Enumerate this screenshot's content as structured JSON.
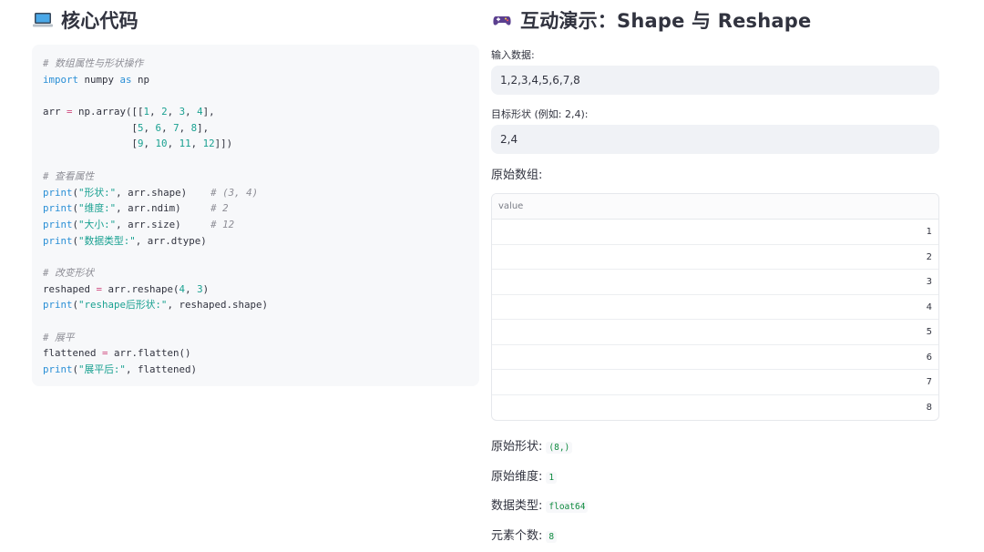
{
  "left": {
    "title_icon": "laptop-icon",
    "title": "核心代码",
    "code_lines": [
      "# 数组属性与形状操作",
      "import numpy as np",
      "",
      "arr = np.array([[1, 2, 3, 4],",
      "               [5, 6, 7, 8],",
      "               [9, 10, 11, 12]])",
      "",
      "# 查看属性",
      "print(\"形状:\", arr.shape)    # (3, 4)",
      "print(\"维度:\", arr.ndim)     # 2",
      "print(\"大小:\", arr.size)     # 12",
      "print(\"数据类型:\", arr.dtype)",
      "",
      "# 改变形状",
      "reshaped = arr.reshape(4, 3)",
      "print(\"reshape后形状:\", reshaped.shape)",
      "",
      "# 展平",
      "flattened = arr.flatten()",
      "print(\"展平后:\", flattened)"
    ]
  },
  "right": {
    "title_icon": "gamepad-icon",
    "title": "互动演示：Shape 与 Reshape",
    "input_label": "输入数据:",
    "input_value": "1,2,3,4,5,6,7,8",
    "shape_label": "目标形状 (例如: 2,4):",
    "shape_value": "2,4",
    "original_label": "原始数组:",
    "table_header": "value",
    "table_rows": [
      "1",
      "2",
      "3",
      "4",
      "5",
      "6",
      "7",
      "8"
    ],
    "stats": [
      {
        "label": "原始形状:",
        "value": "(8,)"
      },
      {
        "label": "原始维度:",
        "value": "1"
      },
      {
        "label": "数据类型:",
        "value": "float64"
      },
      {
        "label": "元素个数:",
        "value": "8"
      }
    ]
  },
  "colors": {
    "keyword": "#2a8fd6",
    "number": "#1aa191",
    "comment": "#8e8e96",
    "inline_code": "#0e8a3e"
  }
}
